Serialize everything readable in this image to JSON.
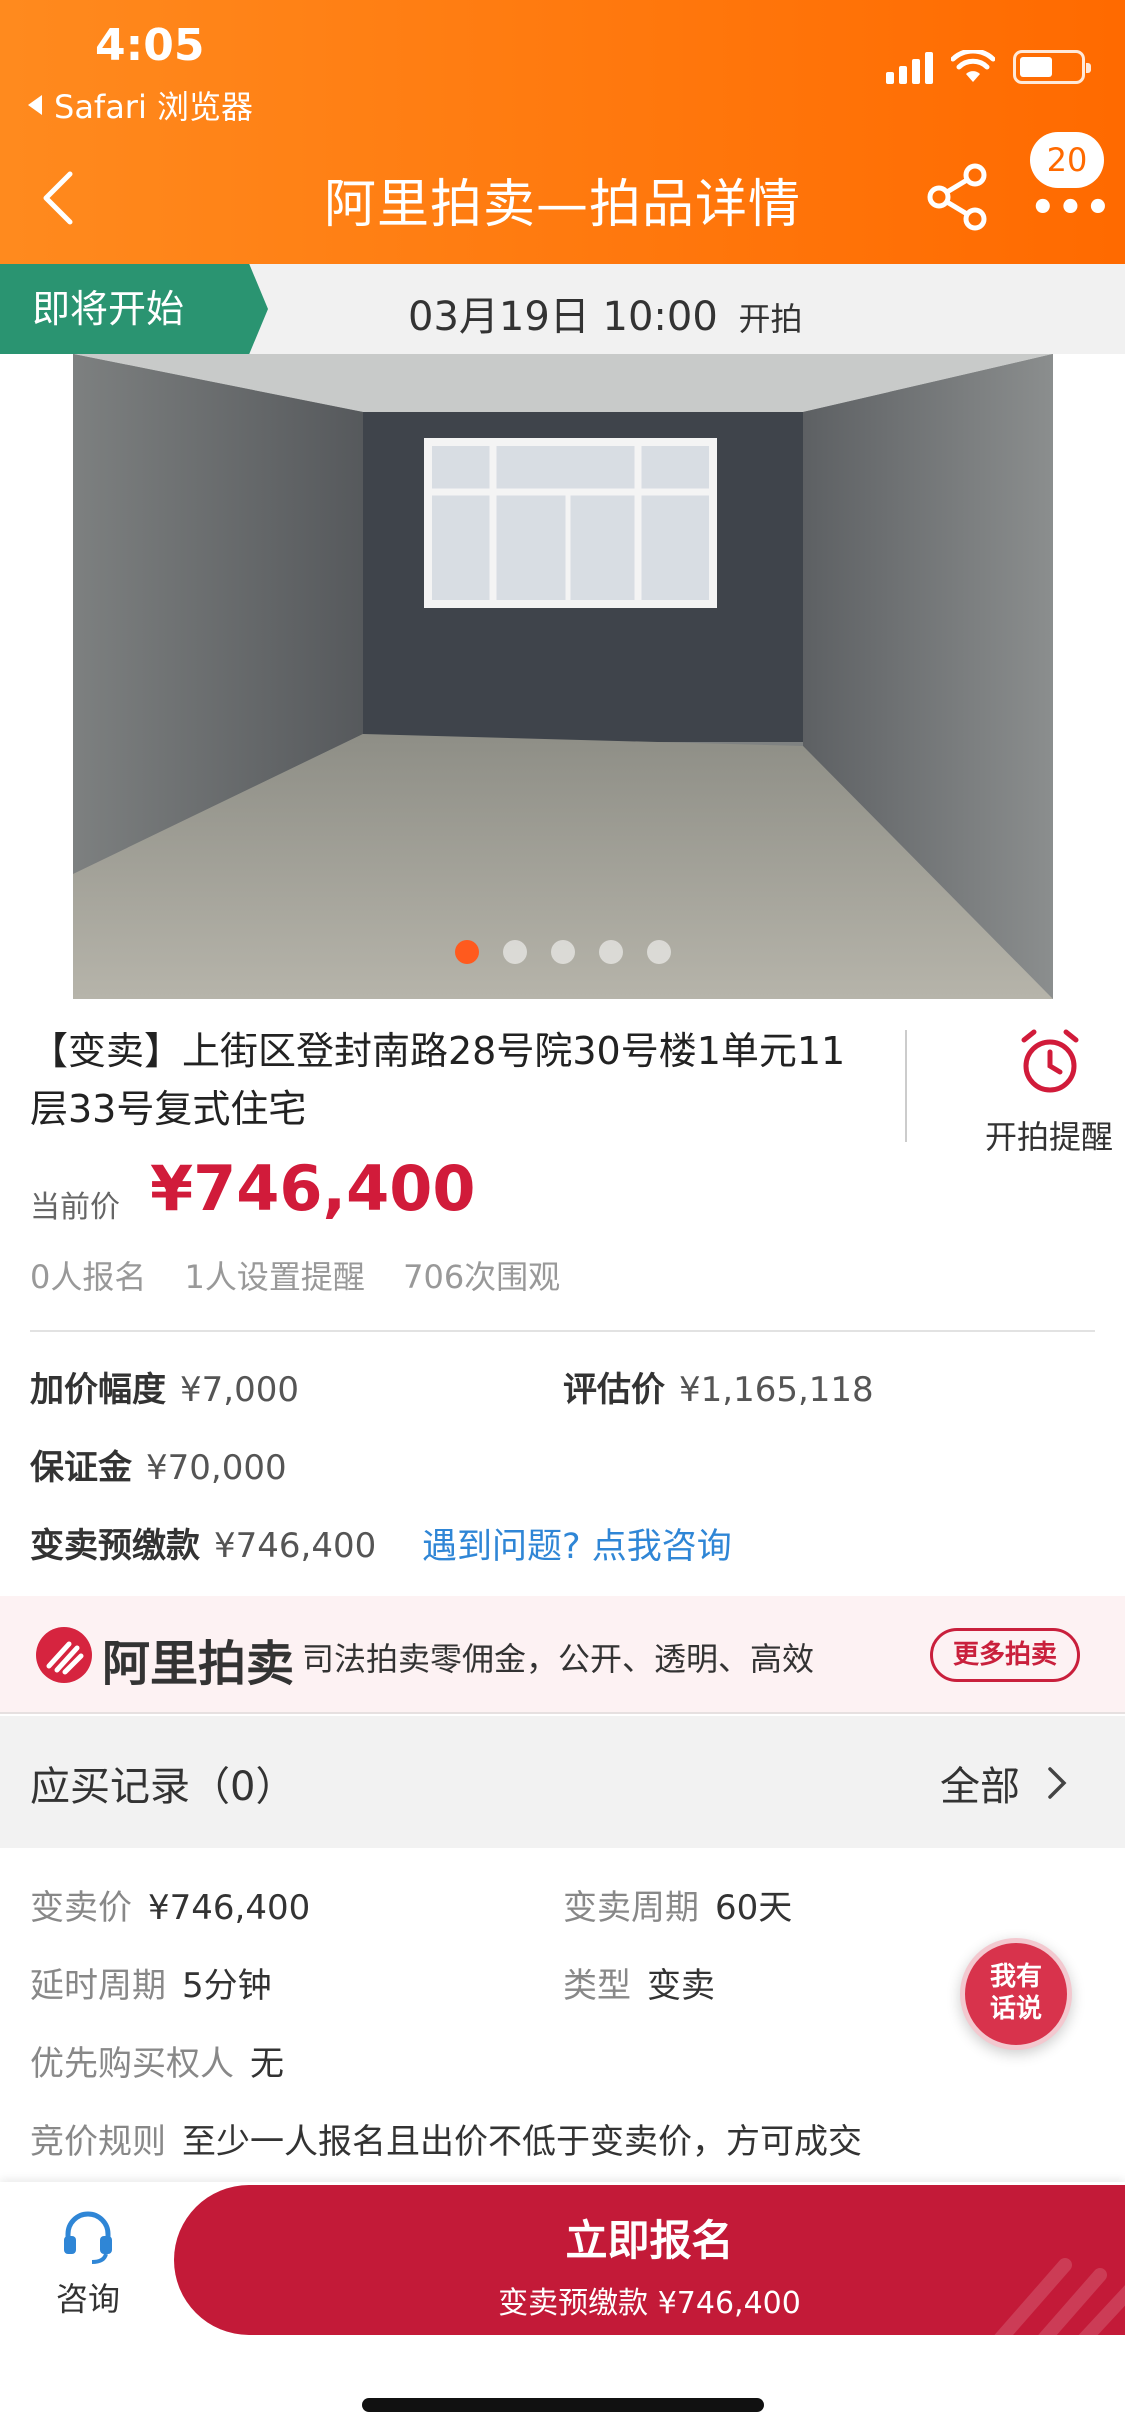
{
  "status_bar": {
    "time": "4:05",
    "back_app": "Safari 浏览器"
  },
  "nav": {
    "title": "阿里拍卖—拍品详情",
    "badge_count": "20",
    "more": "•••"
  },
  "auction_strip": {
    "status": "即将开始",
    "date_time": "03月19日  10:00",
    "suffix": "开拍"
  },
  "photo": {
    "total_slides": 5,
    "active_index": 0
  },
  "item": {
    "title": "【变卖】上街区登封南路28号院30号楼1单元11层33号复式住宅",
    "remind_label": "开拍提醒",
    "price_label": "当前价",
    "price": "¥746,400",
    "stats": [
      "0人报名",
      "1人设置提醒",
      "706次围观"
    ]
  },
  "fees": {
    "increment_label": "加价幅度",
    "increment_value": "¥7,000",
    "appraisal_label": "评估价",
    "appraisal_value": "¥1,165,118",
    "deposit_label": "保证金",
    "deposit_value": "¥70,000",
    "prepay_label": "变卖预缴款",
    "prepay_value": "¥746,400",
    "consult_link": "遇到问题? 点我咨询"
  },
  "banner": {
    "brand": "阿里拍卖",
    "slogan": "司法拍卖零佣金，公开、透明、高效",
    "more_button": "更多拍卖"
  },
  "records": {
    "title": "应买记录（0）",
    "all_label": "全部"
  },
  "details": {
    "sale_price_label": "变卖价",
    "sale_price_value": "¥746,400",
    "period_label": "变卖周期",
    "period_value": "60天",
    "delay_label": "延时周期",
    "delay_value": "5分钟",
    "type_label": "类型",
    "type_value": "变卖",
    "priority_label": "优先购买权人",
    "priority_value": "无",
    "rule_label": "竞价规则",
    "rule_value": "至少一人报名且出价不低于变卖价，方可成交"
  },
  "float_chat": {
    "line1": "我有",
    "line2": "话说"
  },
  "bottom_bar": {
    "consult_label": "咨询",
    "signup_label": "立即报名",
    "signup_sub": "变卖预缴款 ¥746,400"
  },
  "colors": {
    "header": "#ff6a00",
    "accent_red": "#c31a38",
    "status_green": "#2a9471",
    "link_blue": "#2f86d6"
  }
}
